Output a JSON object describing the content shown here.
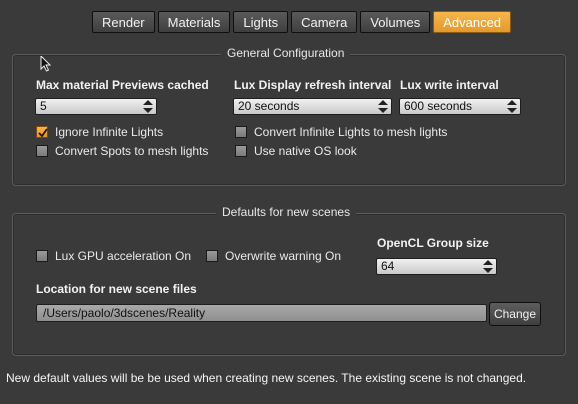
{
  "tabs": [
    {
      "label": "Render"
    },
    {
      "label": "Materials"
    },
    {
      "label": "Lights"
    },
    {
      "label": "Camera"
    },
    {
      "label": "Volumes"
    },
    {
      "label": "Advanced",
      "active": true
    }
  ],
  "general": {
    "title": "General Configuration",
    "max_previews_label": "Max material Previews cached",
    "max_previews_value": "5",
    "refresh_label": "Lux Display refresh interval",
    "refresh_value": "20 seconds",
    "write_label": "Lux write interval",
    "write_value": "600 seconds",
    "ignore_infinite": {
      "label": "Ignore Infinite Lights",
      "checked": true
    },
    "convert_spots": {
      "label": "Convert Spots to mesh lights",
      "checked": false
    },
    "convert_infinite": {
      "label": "Convert Infinite Lights to mesh lights",
      "checked": false
    },
    "native_os": {
      "label": "Use native OS look",
      "checked": false
    }
  },
  "defaults": {
    "title": "Defaults for new scenes",
    "gpu": {
      "label": "Lux GPU acceleration On",
      "checked": false
    },
    "overwrite": {
      "label": "Overwrite warning On",
      "checked": false
    },
    "opencl_label": "OpenCL Group size",
    "opencl_value": "64",
    "location_label": "Location for new scene files",
    "location_value": "/Users/paolo/3dscenes/Reality",
    "change_button": "Change"
  },
  "footer_note": "New default values will be be used when creating new scenes. The existing scene is not changed.",
  "colors": {
    "accent": "#f0a838",
    "background": "#3a3a3a"
  }
}
